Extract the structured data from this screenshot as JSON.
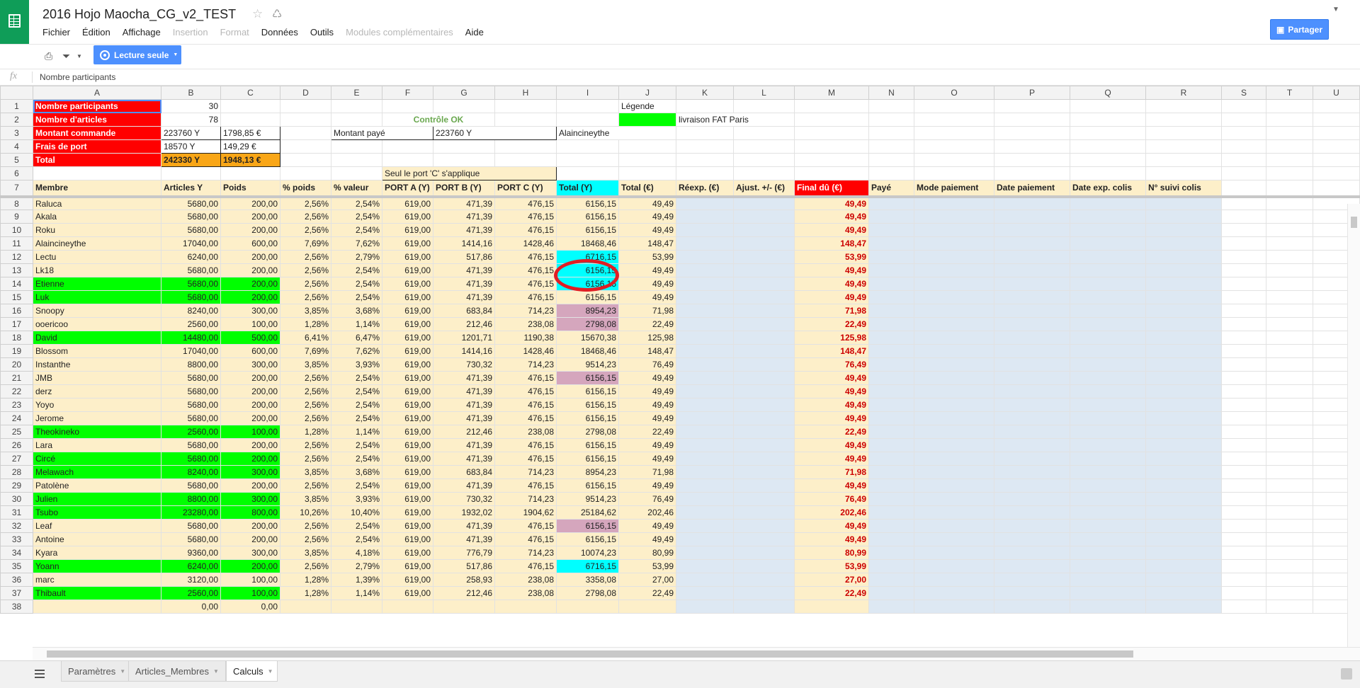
{
  "app": {
    "title": "2016 Hojo Maocha_CG_v2_TEST",
    "menu": [
      {
        "label": "Fichier",
        "disabled": false
      },
      {
        "label": "Édition",
        "disabled": false
      },
      {
        "label": "Affichage",
        "disabled": false
      },
      {
        "label": "Insertion",
        "disabled": true
      },
      {
        "label": "Format",
        "disabled": true
      },
      {
        "label": "Données",
        "disabled": false
      },
      {
        "label": "Outils",
        "disabled": false
      },
      {
        "label": "Modules complémentaires",
        "disabled": true
      },
      {
        "label": "Aide",
        "disabled": false
      }
    ],
    "share_label": "Partager",
    "readonly_label": "Lecture seule",
    "formula_label": "fx",
    "formula_value": "Nombre participants"
  },
  "grid": {
    "columns": [
      "A",
      "B",
      "C",
      "D",
      "E",
      "F",
      "G",
      "H",
      "I",
      "J",
      "K",
      "L",
      "M",
      "N",
      "O",
      "P",
      "Q",
      "R",
      "S",
      "T",
      "U"
    ],
    "summary": {
      "nb_participants_label": "Nombre participants",
      "nb_participants": "30",
      "nb_articles_label": "Nombre d'articles",
      "nb_articles": "78",
      "montant_label": "Montant commande",
      "montant_y": "223760 Y",
      "montant_eur": "1798,85 €",
      "frais_label": "Frais de port",
      "frais_y": "18570 Y",
      "frais_eur": "149,29 €",
      "total_label": "Total",
      "total_y": "242330 Y",
      "total_eur": "1948,13 €",
      "controle": "Contrôle OK",
      "montant_paye_label": "Montant payé",
      "montant_paye": "223760 Y",
      "payeur": "Alaincineythe",
      "legende_label": "Légende",
      "legende_item": "livraison FAT Paris",
      "port_note": "Seul le port 'C' s'applique"
    },
    "headers": [
      "Membre",
      "Articles Y",
      "Poids",
      "% poids",
      "% valeur",
      "PORT A (Y)",
      "PORT B (Y)",
      "PORT C (Y)",
      "Total (Y)",
      "Total (€)",
      "Réexp. (€)",
      "Ajust. +/- (€)",
      "Final dû (€)",
      "Payé",
      "Mode paiement",
      "Date paiement",
      "Date exp. colis",
      "N° suivi colis"
    ],
    "rows": [
      {
        "n": "8",
        "m": "Raluca",
        "a": "5680,00",
        "p": "200,00",
        "pp": "2,56%",
        "pv": "2,54%",
        "pa": "619,00",
        "pb": "471,39",
        "pc": "476,15",
        "ty": "6156,15",
        "te": "49,49",
        "f": "49,49",
        "hl": "",
        "ti": ""
      },
      {
        "n": "9",
        "m": "Akala",
        "a": "5680,00",
        "p": "200,00",
        "pp": "2,56%",
        "pv": "2,54%",
        "pa": "619,00",
        "pb": "471,39",
        "pc": "476,15",
        "ty": "6156,15",
        "te": "49,49",
        "f": "49,49",
        "hl": "",
        "ti": ""
      },
      {
        "n": "10",
        "m": "Roku",
        "a": "5680,00",
        "p": "200,00",
        "pp": "2,56%",
        "pv": "2,54%",
        "pa": "619,00",
        "pb": "471,39",
        "pc": "476,15",
        "ty": "6156,15",
        "te": "49,49",
        "f": "49,49",
        "hl": "",
        "ti": ""
      },
      {
        "n": "11",
        "m": "Alaincineythe",
        "a": "17040,00",
        "p": "600,00",
        "pp": "7,69%",
        "pv": "7,62%",
        "pa": "619,00",
        "pb": "1414,16",
        "pc": "1428,46",
        "ty": "18468,46",
        "te": "148,47",
        "f": "148,47",
        "hl": "",
        "ti": ""
      },
      {
        "n": "12",
        "m": "Lectu",
        "a": "6240,00",
        "p": "200,00",
        "pp": "2,56%",
        "pv": "2,79%",
        "pa": "619,00",
        "pb": "517,86",
        "pc": "476,15",
        "ty": "6716,15",
        "te": "53,99",
        "f": "53,99",
        "hl": "",
        "ti": "cyan"
      },
      {
        "n": "13",
        "m": "Lk18",
        "a": "5680,00",
        "p": "200,00",
        "pp": "2,56%",
        "pv": "2,54%",
        "pa": "619,00",
        "pb": "471,39",
        "pc": "476,15",
        "ty": "6156,15",
        "te": "49,49",
        "f": "49,49",
        "hl": "",
        "ti": "cyan"
      },
      {
        "n": "14",
        "m": "Etienne",
        "a": "5680,00",
        "p": "200,00",
        "pp": "2,56%",
        "pv": "2,54%",
        "pa": "619,00",
        "pb": "471,39",
        "pc": "476,15",
        "ty": "6156,15",
        "te": "49,49",
        "f": "49,49",
        "hl": "green",
        "ti": "cyan"
      },
      {
        "n": "15",
        "m": "Luk",
        "a": "5680,00",
        "p": "200,00",
        "pp": "2,56%",
        "pv": "2,54%",
        "pa": "619,00",
        "pb": "471,39",
        "pc": "476,15",
        "ty": "6156,15",
        "te": "49,49",
        "f": "49,49",
        "hl": "green",
        "ti": ""
      },
      {
        "n": "16",
        "m": "Snoopy",
        "a": "8240,00",
        "p": "300,00",
        "pp": "3,85%",
        "pv": "3,68%",
        "pa": "619,00",
        "pb": "683,84",
        "pc": "714,23",
        "ty": "8954,23",
        "te": "71,98",
        "f": "71,98",
        "hl": "",
        "ti": "mauve"
      },
      {
        "n": "17",
        "m": "ooericoo",
        "a": "2560,00",
        "p": "100,00",
        "pp": "1,28%",
        "pv": "1,14%",
        "pa": "619,00",
        "pb": "212,46",
        "pc": "238,08",
        "ty": "2798,08",
        "te": "22,49",
        "f": "22,49",
        "hl": "",
        "ti": "mauve"
      },
      {
        "n": "18",
        "m": "David",
        "a": "14480,00",
        "p": "500,00",
        "pp": "6,41%",
        "pv": "6,47%",
        "pa": "619,00",
        "pb": "1201,71",
        "pc": "1190,38",
        "ty": "15670,38",
        "te": "125,98",
        "f": "125,98",
        "hl": "green",
        "ti": ""
      },
      {
        "n": "19",
        "m": "Blossom",
        "a": "17040,00",
        "p": "600,00",
        "pp": "7,69%",
        "pv": "7,62%",
        "pa": "619,00",
        "pb": "1414,16",
        "pc": "1428,46",
        "ty": "18468,46",
        "te": "148,47",
        "f": "148,47",
        "hl": "",
        "ti": ""
      },
      {
        "n": "20",
        "m": "Instanthe",
        "a": "8800,00",
        "p": "300,00",
        "pp": "3,85%",
        "pv": "3,93%",
        "pa": "619,00",
        "pb": "730,32",
        "pc": "714,23",
        "ty": "9514,23",
        "te": "76,49",
        "f": "76,49",
        "hl": "",
        "ti": ""
      },
      {
        "n": "21",
        "m": "JMB",
        "a": "5680,00",
        "p": "200,00",
        "pp": "2,56%",
        "pv": "2,54%",
        "pa": "619,00",
        "pb": "471,39",
        "pc": "476,15",
        "ty": "6156,15",
        "te": "49,49",
        "f": "49,49",
        "hl": "",
        "ti": "mauve"
      },
      {
        "n": "22",
        "m": "derz",
        "a": "5680,00",
        "p": "200,00",
        "pp": "2,56%",
        "pv": "2,54%",
        "pa": "619,00",
        "pb": "471,39",
        "pc": "476,15",
        "ty": "6156,15",
        "te": "49,49",
        "f": "49,49",
        "hl": "",
        "ti": ""
      },
      {
        "n": "23",
        "m": "Yoyo",
        "a": "5680,00",
        "p": "200,00",
        "pp": "2,56%",
        "pv": "2,54%",
        "pa": "619,00",
        "pb": "471,39",
        "pc": "476,15",
        "ty": "6156,15",
        "te": "49,49",
        "f": "49,49",
        "hl": "",
        "ti": ""
      },
      {
        "n": "24",
        "m": "Jerome",
        "a": "5680,00",
        "p": "200,00",
        "pp": "2,56%",
        "pv": "2,54%",
        "pa": "619,00",
        "pb": "471,39",
        "pc": "476,15",
        "ty": "6156,15",
        "te": "49,49",
        "f": "49,49",
        "hl": "",
        "ti": ""
      },
      {
        "n": "25",
        "m": "Theokineko",
        "a": "2560,00",
        "p": "100,00",
        "pp": "1,28%",
        "pv": "1,14%",
        "pa": "619,00",
        "pb": "212,46",
        "pc": "238,08",
        "ty": "2798,08",
        "te": "22,49",
        "f": "22,49",
        "hl": "green",
        "ti": ""
      },
      {
        "n": "26",
        "m": "Lara",
        "a": "5680,00",
        "p": "200,00",
        "pp": "2,56%",
        "pv": "2,54%",
        "pa": "619,00",
        "pb": "471,39",
        "pc": "476,15",
        "ty": "6156,15",
        "te": "49,49",
        "f": "49,49",
        "hl": "",
        "ti": ""
      },
      {
        "n": "27",
        "m": "Circé",
        "a": "5680,00",
        "p": "200,00",
        "pp": "2,56%",
        "pv": "2,54%",
        "pa": "619,00",
        "pb": "471,39",
        "pc": "476,15",
        "ty": "6156,15",
        "te": "49,49",
        "f": "49,49",
        "hl": "green",
        "ti": ""
      },
      {
        "n": "28",
        "m": "Melawach",
        "a": "8240,00",
        "p": "300,00",
        "pp": "3,85%",
        "pv": "3,68%",
        "pa": "619,00",
        "pb": "683,84",
        "pc": "714,23",
        "ty": "8954,23",
        "te": "71,98",
        "f": "71,98",
        "hl": "green",
        "ti": ""
      },
      {
        "n": "29",
        "m": "Patolène",
        "a": "5680,00",
        "p": "200,00",
        "pp": "2,56%",
        "pv": "2,54%",
        "pa": "619,00",
        "pb": "471,39",
        "pc": "476,15",
        "ty": "6156,15",
        "te": "49,49",
        "f": "49,49",
        "hl": "",
        "ti": ""
      },
      {
        "n": "30",
        "m": "Julien",
        "a": "8800,00",
        "p": "300,00",
        "pp": "3,85%",
        "pv": "3,93%",
        "pa": "619,00",
        "pb": "730,32",
        "pc": "714,23",
        "ty": "9514,23",
        "te": "76,49",
        "f": "76,49",
        "hl": "green",
        "ti": ""
      },
      {
        "n": "31",
        "m": "Tsubo",
        "a": "23280,00",
        "p": "800,00",
        "pp": "10,26%",
        "pv": "10,40%",
        "pa": "619,00",
        "pb": "1932,02",
        "pc": "1904,62",
        "ty": "25184,62",
        "te": "202,46",
        "f": "202,46",
        "hl": "green",
        "ti": ""
      },
      {
        "n": "32",
        "m": "Leaf",
        "a": "5680,00",
        "p": "200,00",
        "pp": "2,56%",
        "pv": "2,54%",
        "pa": "619,00",
        "pb": "471,39",
        "pc": "476,15",
        "ty": "6156,15",
        "te": "49,49",
        "f": "49,49",
        "hl": "",
        "ti": "mauve"
      },
      {
        "n": "33",
        "m": "Antoine",
        "a": "5680,00",
        "p": "200,00",
        "pp": "2,56%",
        "pv": "2,54%",
        "pa": "619,00",
        "pb": "471,39",
        "pc": "476,15",
        "ty": "6156,15",
        "te": "49,49",
        "f": "49,49",
        "hl": "",
        "ti": ""
      },
      {
        "n": "34",
        "m": "Kyara",
        "a": "9360,00",
        "p": "300,00",
        "pp": "3,85%",
        "pv": "4,18%",
        "pa": "619,00",
        "pb": "776,79",
        "pc": "714,23",
        "ty": "10074,23",
        "te": "80,99",
        "f": "80,99",
        "hl": "",
        "ti": ""
      },
      {
        "n": "35",
        "m": "Yoann",
        "a": "6240,00",
        "p": "200,00",
        "pp": "2,56%",
        "pv": "2,79%",
        "pa": "619,00",
        "pb": "517,86",
        "pc": "476,15",
        "ty": "6716,15",
        "te": "53,99",
        "f": "53,99",
        "hl": "green",
        "ti": "cyan"
      },
      {
        "n": "36",
        "m": "marc",
        "a": "3120,00",
        "p": "100,00",
        "pp": "1,28%",
        "pv": "1,39%",
        "pa": "619,00",
        "pb": "258,93",
        "pc": "238,08",
        "ty": "3358,08",
        "te": "27,00",
        "f": "27,00",
        "hl": "",
        "ti": ""
      },
      {
        "n": "37",
        "m": "Thibault",
        "a": "2560,00",
        "p": "100,00",
        "pp": "1,28%",
        "pv": "1,14%",
        "pa": "619,00",
        "pb": "212,46",
        "pc": "238,08",
        "ty": "2798,08",
        "te": "22,49",
        "f": "22,49",
        "hl": "green",
        "ti": ""
      },
      {
        "n": "38",
        "m": "",
        "a": "0,00",
        "p": "0,00",
        "pp": "",
        "pv": "",
        "pa": "",
        "pb": "",
        "pc": "",
        "ty": "",
        "te": "",
        "f": "",
        "hl": "",
        "ti": ""
      }
    ]
  },
  "tabs": [
    {
      "label": "Paramètres",
      "active": false
    },
    {
      "label": "Articles_Membres",
      "active": false
    },
    {
      "label": "Calculs",
      "active": true
    }
  ],
  "colors": {
    "green": "#00ff00",
    "red": "#ff0000",
    "cyan": "#00ffff",
    "mauve": "#d5a6bd",
    "beige": "#fdefc9",
    "blue": "#dde8f3",
    "accent": "#4d90fe"
  }
}
